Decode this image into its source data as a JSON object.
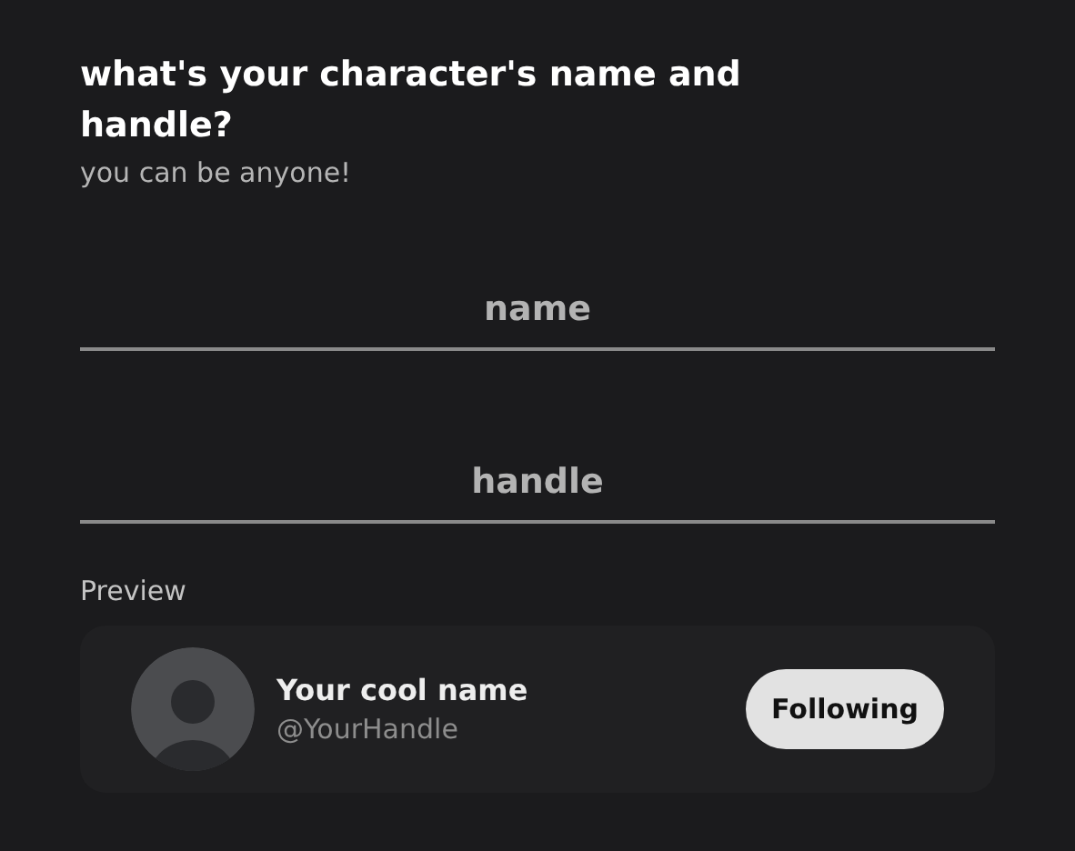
{
  "heading": {
    "title": "what's your character's name and handle?",
    "subtitle": "you can be anyone!"
  },
  "fields": [
    {
      "placeholder": "name"
    },
    {
      "placeholder": "handle"
    }
  ],
  "preview": {
    "label": "Preview",
    "name": "Your cool name",
    "handle": "@YourHandle",
    "button": "Following"
  }
}
